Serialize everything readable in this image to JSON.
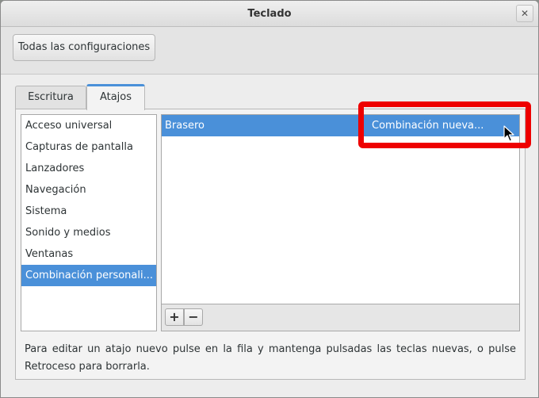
{
  "window": {
    "title": "Teclado",
    "close_glyph": "✕"
  },
  "toolbar": {
    "all_settings_label": "Todas las configuraciones"
  },
  "tabs": [
    {
      "label": "Escritura",
      "active": false
    },
    {
      "label": "Atajos",
      "active": true
    }
  ],
  "categories": [
    {
      "label": "Acceso universal"
    },
    {
      "label": "Capturas de pantalla"
    },
    {
      "label": "Lanzadores"
    },
    {
      "label": "Navegación"
    },
    {
      "label": "Sistema"
    },
    {
      "label": "Sonido y medios"
    },
    {
      "label": "Ventanas"
    },
    {
      "label": "Combinación personali...",
      "selected": true
    }
  ],
  "shortcuts": [
    {
      "name": "Brasero",
      "accelerator": "Combinación nueva...",
      "selected": true
    }
  ],
  "list_tools": {
    "add_glyph": "+",
    "remove_glyph": "−"
  },
  "help_text": "Para editar un atajo nuevo pulse en la fila y mantenga pulsadas las teclas nuevas, o pulse Retroceso para borrarla.",
  "colors": {
    "selection": "#4a90d9",
    "highlight_annotation": "#ee0000"
  },
  "icons": {
    "cursor": "mouse-pointer-icon"
  }
}
